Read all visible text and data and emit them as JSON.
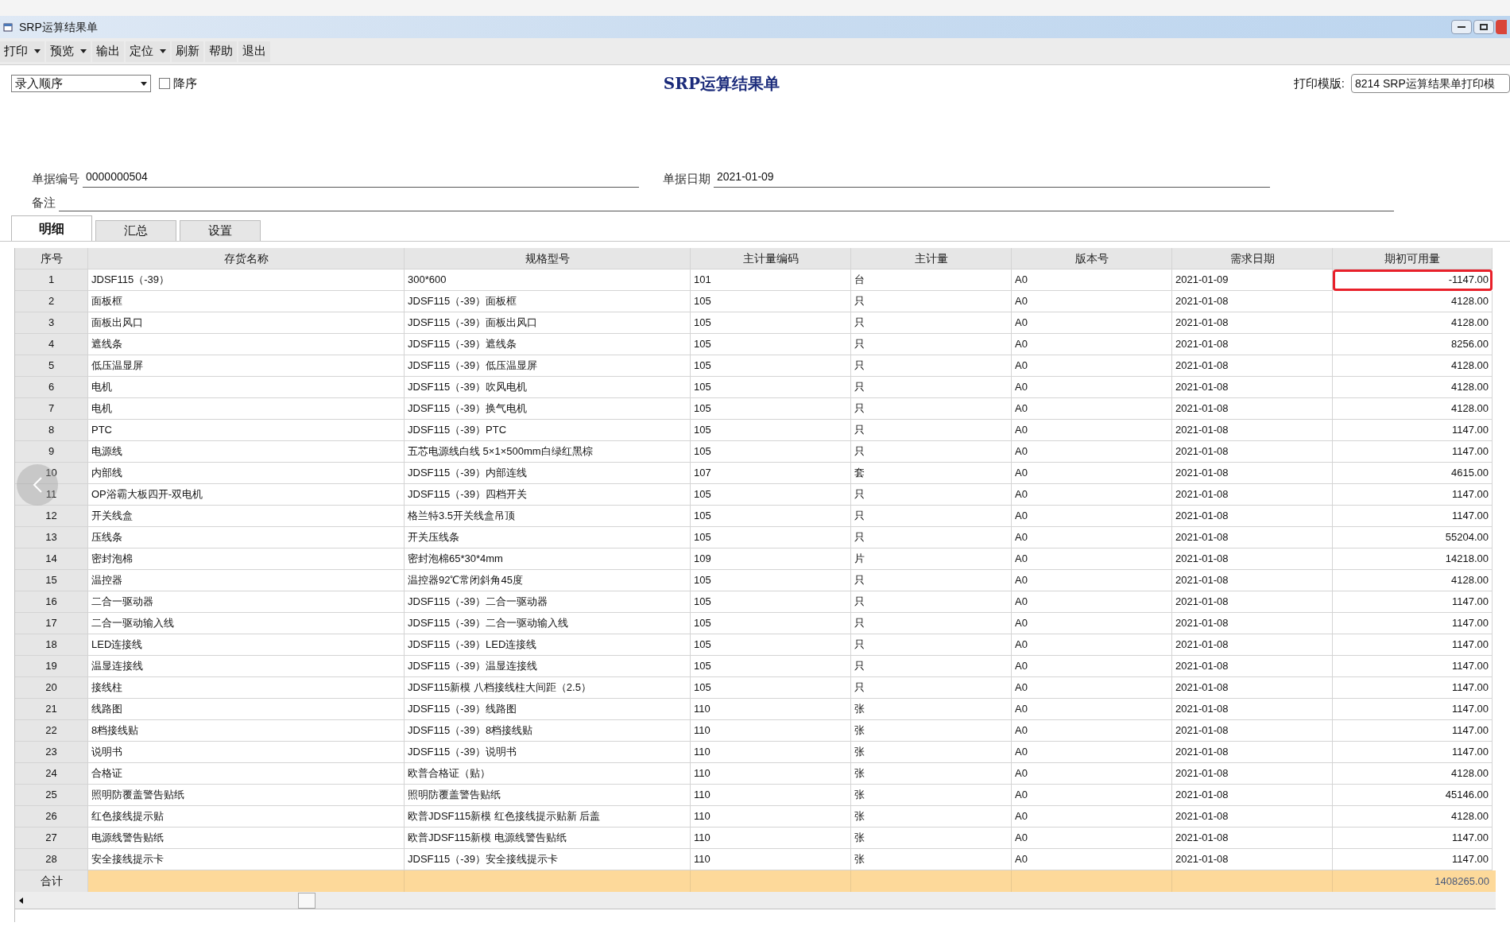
{
  "window": {
    "title": "SRP运算结果单"
  },
  "toolbar": [
    {
      "label": "打印",
      "kind": "dropdown"
    },
    {
      "label": "预览",
      "kind": "dropdown"
    },
    {
      "label": "输出",
      "kind": "button"
    },
    {
      "label": "定位",
      "kind": "dropdown"
    },
    {
      "label": "刷新",
      "kind": "button"
    },
    {
      "label": "帮助",
      "kind": "button"
    },
    {
      "label": "退出",
      "kind": "button"
    }
  ],
  "sort_select": {
    "value": "录入顺序"
  },
  "descending": {
    "label": "降序",
    "checked": false
  },
  "report_title": "SRP运算结果单",
  "template": {
    "label": "打印模版:",
    "value": "8214 SRP运算结果单打印模"
  },
  "fields": [
    {
      "label": "单据编号",
      "value": "0000000504"
    },
    {
      "label": "单据日期",
      "value": "2021-01-09"
    }
  ],
  "remark": {
    "label": "备注"
  },
  "tabs": [
    {
      "label": "明细",
      "selected": true
    },
    {
      "label": "汇总",
      "selected": false
    },
    {
      "label": "设置",
      "selected": false
    }
  ],
  "table": {
    "columns": [
      "序号",
      "存货名称",
      "规格型号",
      "主计量编码",
      "主计量",
      "版本号",
      "需求日期",
      "期初可用量"
    ],
    "rows": [
      {
        "cells": [
          "1",
          "JDSF115（-39）",
          "300*600",
          "101",
          "台",
          "A0",
          "2021-01-09",
          "-1147.00"
        ],
        "highlighted": true
      },
      {
        "cells": [
          "2",
          "面板框",
          "JDSF115（-39）面板框",
          "105",
          "只",
          "A0",
          "2021-01-08",
          "4128.00"
        ],
        "highlighted": false
      },
      {
        "cells": [
          "3",
          "面板出风口",
          "JDSF115（-39）面板出风口",
          "105",
          "只",
          "A0",
          "2021-01-08",
          "4128.00"
        ],
        "highlighted": false
      },
      {
        "cells": [
          "4",
          "遮线条",
          "JDSF115（-39）遮线条",
          "105",
          "只",
          "A0",
          "2021-01-08",
          "8256.00"
        ],
        "highlighted": false
      },
      {
        "cells": [
          "5",
          "低压温显屏",
          "JDSF115（-39）低压温显屏",
          "105",
          "只",
          "A0",
          "2021-01-08",
          "4128.00"
        ],
        "highlighted": false
      },
      {
        "cells": [
          "6",
          "电机",
          "JDSF115（-39）吹风电机",
          "105",
          "只",
          "A0",
          "2021-01-08",
          "4128.00"
        ],
        "highlighted": false
      },
      {
        "cells": [
          "7",
          "电机",
          "JDSF115（-39）换气电机",
          "105",
          "只",
          "A0",
          "2021-01-08",
          "4128.00"
        ],
        "highlighted": false
      },
      {
        "cells": [
          "8",
          "PTC",
          "JDSF115（-39）PTC",
          "105",
          "只",
          "A0",
          "2021-01-08",
          "1147.00"
        ],
        "highlighted": false
      },
      {
        "cells": [
          "9",
          "电源线",
          "五芯电源线白线 5×1×500mm白绿红黑棕",
          "105",
          "只",
          "A0",
          "2021-01-08",
          "1147.00"
        ],
        "highlighted": false
      },
      {
        "cells": [
          "10",
          "内部线",
          "JDSF115（-39）内部连线",
          "107",
          "套",
          "A0",
          "2021-01-08",
          "4615.00"
        ],
        "highlighted": false
      },
      {
        "cells": [
          "11",
          "OP浴霸大板四开-双电机",
          "JDSF115（-39）四档开关",
          "105",
          "只",
          "A0",
          "2021-01-08",
          "1147.00"
        ],
        "highlighted": false
      },
      {
        "cells": [
          "12",
          "开关线盒",
          "格兰特3.5开关线盒吊顶",
          "105",
          "只",
          "A0",
          "2021-01-08",
          "1147.00"
        ],
        "highlighted": false
      },
      {
        "cells": [
          "13",
          "压线条",
          "开关压线条",
          "105",
          "只",
          "A0",
          "2021-01-08",
          "55204.00"
        ],
        "highlighted": false
      },
      {
        "cells": [
          "14",
          "密封泡棉",
          "密封泡棉65*30*4mm",
          "109",
          "片",
          "A0",
          "2021-01-08",
          "14218.00"
        ],
        "highlighted": false
      },
      {
        "cells": [
          "15",
          "温控器",
          "温控器92℃常闭斜角45度",
          "105",
          "只",
          "A0",
          "2021-01-08",
          "4128.00"
        ],
        "highlighted": false
      },
      {
        "cells": [
          "16",
          "二合一驱动器",
          "JDSF115（-39）二合一驱动器",
          "105",
          "只",
          "A0",
          "2021-01-08",
          "1147.00"
        ],
        "highlighted": false
      },
      {
        "cells": [
          "17",
          "二合一驱动输入线",
          "JDSF115（-39）二合一驱动输入线",
          "105",
          "只",
          "A0",
          "2021-01-08",
          "1147.00"
        ],
        "highlighted": false
      },
      {
        "cells": [
          "18",
          "LED连接线",
          "JDSF115（-39）LED连接线",
          "105",
          "只",
          "A0",
          "2021-01-08",
          "1147.00"
        ],
        "highlighted": false
      },
      {
        "cells": [
          "19",
          "温显连接线",
          "JDSF115（-39）温显连接线",
          "105",
          "只",
          "A0",
          "2021-01-08",
          "1147.00"
        ],
        "highlighted": false
      },
      {
        "cells": [
          "20",
          "接线柱",
          "JDSF115新模 八档接线柱大间距（2.5）",
          "105",
          "只",
          "A0",
          "2021-01-08",
          "1147.00"
        ],
        "highlighted": false
      },
      {
        "cells": [
          "21",
          "线路图",
          "JDSF115（-39）线路图",
          "110",
          "张",
          "A0",
          "2021-01-08",
          "1147.00"
        ],
        "highlighted": false
      },
      {
        "cells": [
          "22",
          "8档接线贴",
          "JDSF115（-39）8档接线贴",
          "110",
          "张",
          "A0",
          "2021-01-08",
          "1147.00"
        ],
        "highlighted": false
      },
      {
        "cells": [
          "23",
          "说明书",
          "JDSF115（-39）说明书",
          "110",
          "张",
          "A0",
          "2021-01-08",
          "1147.00"
        ],
        "highlighted": false
      },
      {
        "cells": [
          "24",
          "合格证",
          "欧普合格证（贴）",
          "110",
          "张",
          "A0",
          "2021-01-08",
          "4128.00"
        ],
        "highlighted": false
      },
      {
        "cells": [
          "25",
          "照明防覆盖警告贴纸",
          "照明防覆盖警告贴纸",
          "110",
          "张",
          "A0",
          "2021-01-08",
          "45146.00"
        ],
        "highlighted": false
      },
      {
        "cells": [
          "26",
          "红色接线提示贴",
          "欧普JDSF115新模 红色接线提示贴新 后盖",
          "110",
          "张",
          "A0",
          "2021-01-08",
          "4128.00"
        ],
        "highlighted": false
      },
      {
        "cells": [
          "27",
          "电源线警告贴纸",
          "欧普JDSF115新模 电源线警告贴纸",
          "110",
          "张",
          "A0",
          "2021-01-08",
          "1147.00"
        ],
        "highlighted": false
      },
      {
        "cells": [
          "28",
          "安全接线提示卡",
          "JDSF115（-39）安全接线提示卡",
          "110",
          "张",
          "A0",
          "2021-01-08",
          "1147.00"
        ],
        "highlighted": false
      }
    ],
    "total": {
      "label": "合计",
      "value": "1408265.00"
    }
  }
}
